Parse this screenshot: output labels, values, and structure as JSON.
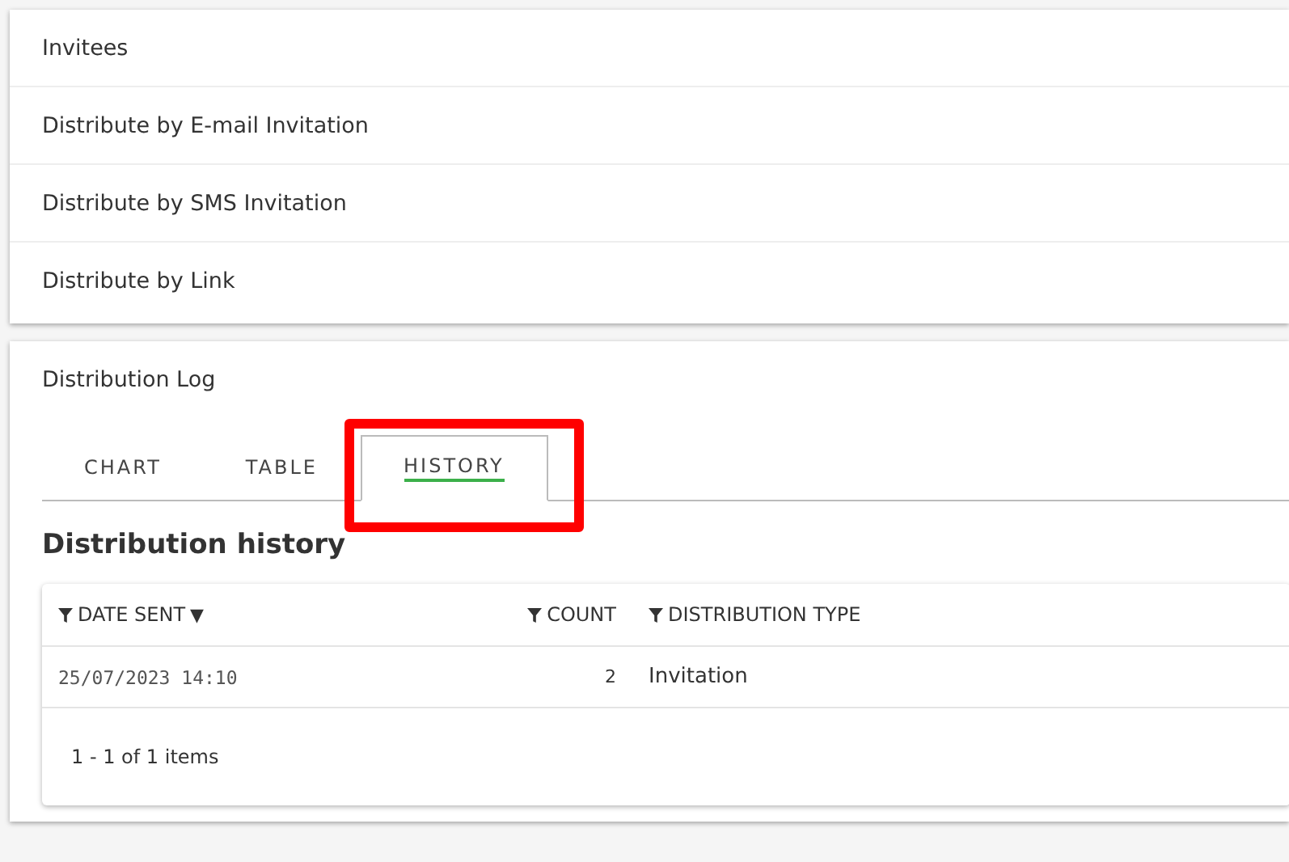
{
  "sections": [
    {
      "label": "Invitees"
    },
    {
      "label": "Distribute by E-mail Invitation"
    },
    {
      "label": "Distribute by SMS Invitation"
    },
    {
      "label": "Distribute by Link"
    }
  ],
  "log": {
    "title": "Distribution Log",
    "tabs": [
      {
        "label": "CHART",
        "selected": false
      },
      {
        "label": "TABLE",
        "selected": false
      },
      {
        "label": "HISTORY",
        "selected": true
      }
    ],
    "heading": "Distribution history",
    "table": {
      "columns": [
        {
          "label": "DATE SENT",
          "sort": "▼"
        },
        {
          "label": "COUNT"
        },
        {
          "label": "DISTRIBUTION TYPE"
        }
      ],
      "rows": [
        [
          "25/07/2023 14:10",
          "2",
          "Invitation"
        ]
      ]
    },
    "pager": "1 - 1 of 1 items"
  }
}
